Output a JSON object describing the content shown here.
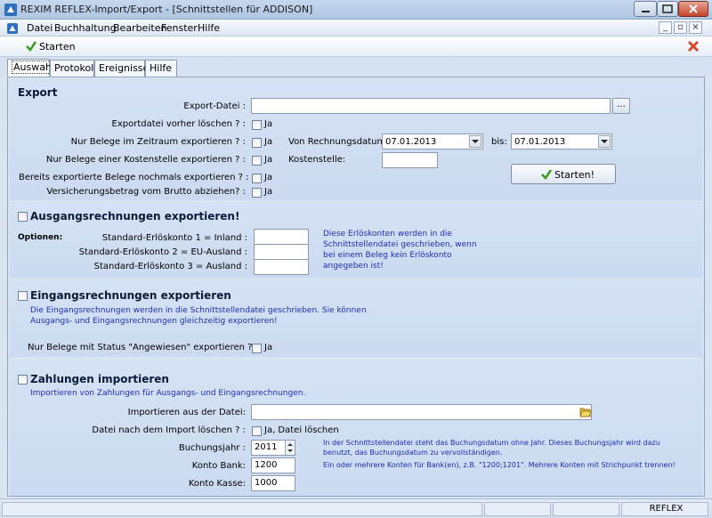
{
  "window": {
    "title": "REXIM REFLEX-Import/Export - [Schnittstellen für ADDISON]"
  },
  "menu": {
    "items": [
      "Datei",
      "Buchhaltung",
      "Bearbeiten",
      "Fenster",
      "Hilfe"
    ]
  },
  "toolbar": {
    "start_label": "Starten"
  },
  "tabs": [
    "Auswahl",
    "Protokoll",
    "Ereignisse",
    "Hilfe"
  ],
  "export": {
    "heading": "Export",
    "file_label": "Export-Datei :",
    "file_value": "",
    "browse_label": "...",
    "delete_label": "Exportdatei vorher löschen ? :",
    "only_period_label": "Nur Belege im Zeitraum exportieren ? :",
    "only_costcenter_label": "Nur Belege einer Kostenstelle exportieren ? :",
    "reexport_label": "Bereits exportierte Belege nochmals exportieren ? :",
    "insurance_label": "Versicherungsbetrag vom Brutto abziehen? :",
    "ja": "Ja",
    "from_date_label": "Von Rechnungsdatum:",
    "from_date": "07.01.2013",
    "to_label": "bis:",
    "to_date": "07.01.2013",
    "costcenter_label": "Kostenstelle:",
    "costcenter_value": "",
    "start_button": "Starten!"
  },
  "ausgang": {
    "heading": "Ausgangsrechnungen exportieren!",
    "options_label": "Optionen:",
    "acct1_label": "Standard-Erlöskonto 1 = Inland :",
    "acct2_label": "Standard-Erlöskonto 2 = EU-Ausland :",
    "acct3_label": "Standard-Erlöskonto 3 = Ausland :",
    "acct1_value": "",
    "acct2_value": "",
    "acct3_value": "",
    "info_lines": [
      "Diese Erlöskonten werden in die",
      "Schnittstellendatei geschrieben, wenn",
      "bei einem Beleg kein Erlöskonto",
      "angegeben ist!"
    ]
  },
  "eingang": {
    "heading": "Eingangsrechnungen exportieren",
    "info_lines": [
      "Die Eingangsrechnungen werden in die Schnittstellendatei geschrieben. Sie können",
      "Ausgangs- und Eingangsrechnungen gleichzeitig exportieren!"
    ],
    "status_label": "Nur Belege mit Status \"Angewiesen\" exportieren ? :",
    "ja": "Ja"
  },
  "zahlungen": {
    "heading": "Zahlungen importieren",
    "info": "Importieren von Zahlungen für Ausgangs- und Eingangsrechnungen.",
    "file_label": "Importieren aus der Datei:",
    "file_value": "",
    "delete_label": "Datei nach dem Import löschen ? :",
    "delete_ja": "Ja, Datei löschen",
    "year_label": "Buchungsjahr :",
    "year_value": "2011",
    "bank_label": "Konto Bank:",
    "bank_value": "1200",
    "kasse_label": "Konto Kasse:",
    "kasse_value": "1000",
    "note_lines": [
      "In der Schnittstellendatei steht das Buchungsdatum ohne Jahr. Dieses Buchungsjahr wird dazu",
      "benutzt, das Buchungsdatum zu vervollständigen."
    ],
    "note2": "Ein oder mehrere Konten für Bank(en), z.B. \"1200;1201\". Mehrere Konten mit Strichpunkt trennen!"
  },
  "statusbar": {
    "app": "REFLEX"
  },
  "colors": {
    "section_bg": "#d0def3",
    "info_text": "#1d2cb0",
    "check_green": "#3a9a1e",
    "close_red": "#c6442a"
  }
}
